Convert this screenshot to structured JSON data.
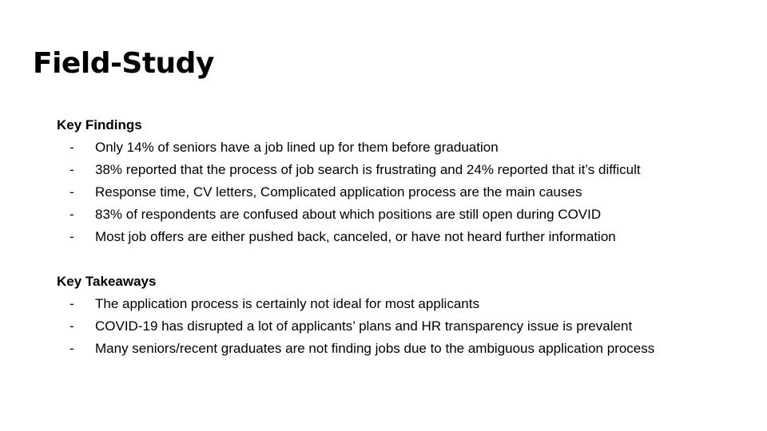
{
  "slide": {
    "title": "Field-Study",
    "sections": [
      {
        "heading": "Key Findings",
        "bullet": "-",
        "items": [
          "Only 14% of seniors have a job lined up for them before graduation",
          "38% reported that the process of job search is frustrating and 24% reported that it’s difficult",
          "Response time, CV letters, Complicated application process are the main causes",
          "83% of respondents are confused about which positions are still open during COVID",
          "Most job offers are either pushed back, canceled, or have not heard further information"
        ]
      },
      {
        "heading": "Key Takeaways",
        "bullet": "-",
        "items": [
          "The application process is certainly not ideal for most applicants",
          "COVID-19 has disrupted a lot of applicants’ plans and HR transparency issue is prevalent",
          "Many seniors/recent graduates are not finding jobs due to the ambiguous application process"
        ]
      }
    ]
  },
  "colors": {
    "background": "#ffffff",
    "text": "#000000"
  }
}
